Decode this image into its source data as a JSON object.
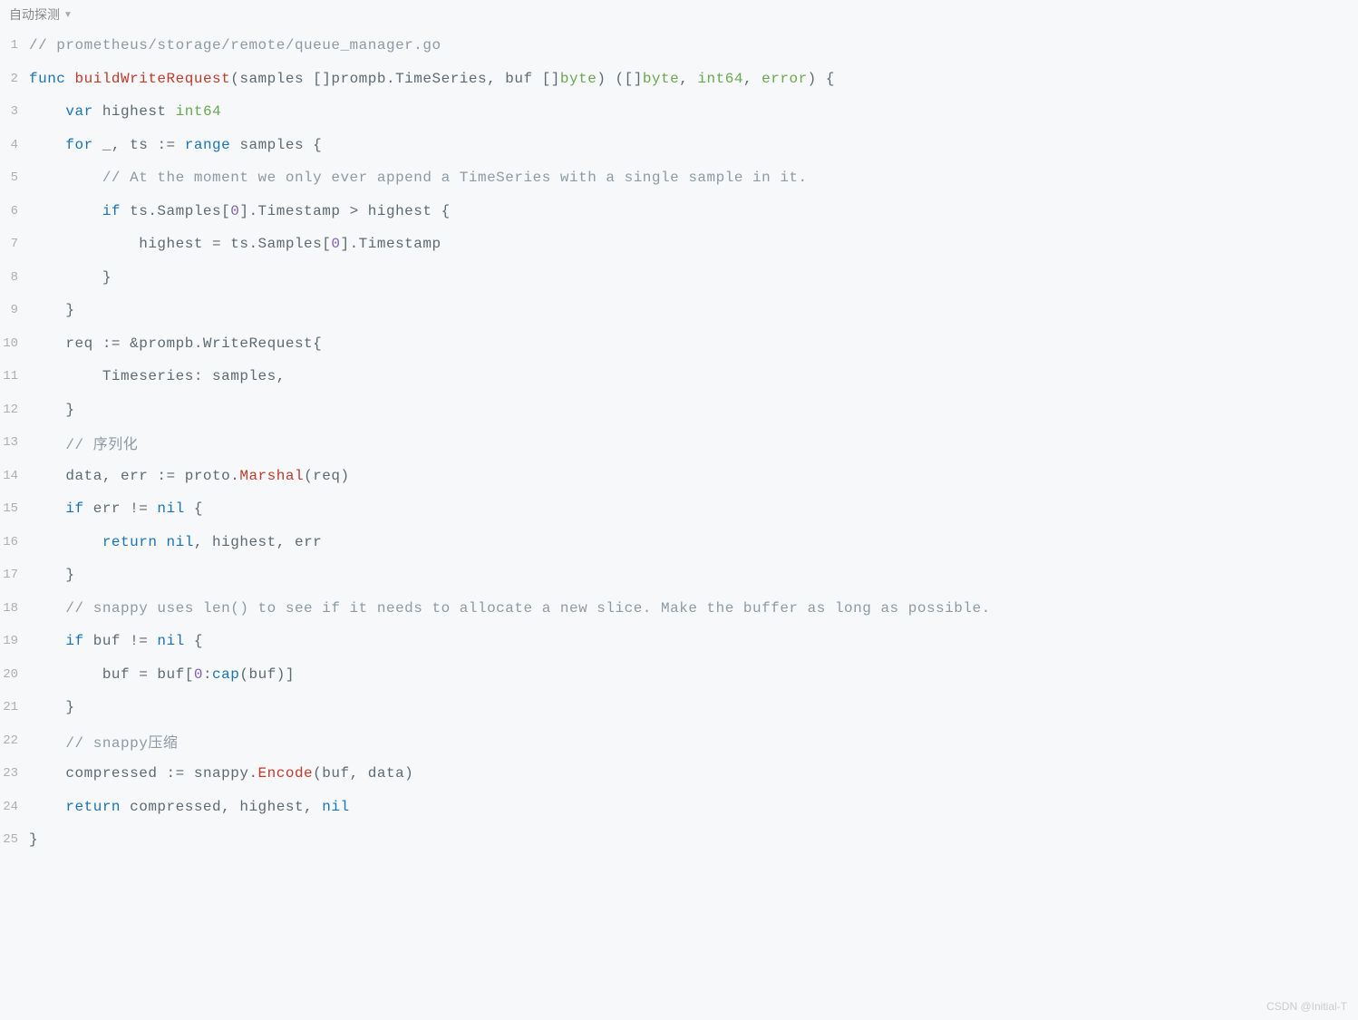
{
  "toolbar": {
    "label": "自动探测"
  },
  "watermark": "CSDN @Initial-T",
  "gutter": {
    "l1": "1",
    "l2": "2",
    "l3": "3",
    "l4": "4",
    "l5": "5",
    "l6": "6",
    "l7": "7",
    "l8": "8",
    "l9": "9",
    "l10": "10",
    "l11": "11",
    "l12": "12",
    "l13": "13",
    "l14": "14",
    "l15": "15",
    "l16": "16",
    "l17": "17",
    "l18": "18",
    "l19": "19",
    "l20": "20",
    "l21": "21",
    "l22": "22",
    "l23": "23",
    "l24": "24",
    "l25": "25"
  },
  "code": {
    "l1_comment": "// prometheus/storage/remote/queue_manager.go",
    "l2": {
      "func": "func",
      "name": "buildWriteRequest",
      "p1": "(samples []prompb.TimeSeries, buf []",
      "byte1": "byte",
      "p2": ") ([]",
      "byte2": "byte",
      "p3": ", ",
      "int64": "int64",
      "p4": ", ",
      "error": "error",
      "p5": ") {"
    },
    "l3": {
      "var": "var",
      "ident": " highest ",
      "type": "int64"
    },
    "l4": {
      "for": "for",
      "blank": " _",
      "p1": ", ts ",
      "assign": ":=",
      "sp": " ",
      "range": "range",
      "rest": " samples {"
    },
    "l5_comment": "// At the moment we only ever append a TimeSeries with a single sample in it.",
    "l6": {
      "if": "if",
      "p1": " ts.Samples[",
      "zero": "0",
      "p2": "].Timestamp > highest {"
    },
    "l7": {
      "p1": "highest = ts.Samples[",
      "zero": "0",
      "p2": "].Timestamp"
    },
    "l8_brace": "}",
    "l9_brace": "}",
    "l10": {
      "p1": "req ",
      "assign": ":=",
      "p2": " &prompb.WriteRequest{"
    },
    "l11": "Timeseries: samples,",
    "l12_brace": "}",
    "l13_comment": "// 序列化",
    "l14": {
      "p1": "data, err ",
      "assign": ":=",
      "p2": " proto.",
      "method": "Marshal",
      "p3": "(req)"
    },
    "l15": {
      "if": "if",
      "p1": " err != ",
      "nil": "nil",
      "p2": " {"
    },
    "l16": {
      "return": "return",
      "sp": " ",
      "nil": "nil",
      "rest": ", highest, err"
    },
    "l17_brace": "}",
    "l18_comment": "// snappy uses len() to see if it needs to allocate a new slice. Make the buffer as long as possible.",
    "l19": {
      "if": "if",
      "p1": " buf != ",
      "nil": "nil",
      "p2": " {"
    },
    "l20": {
      "p1": "buf = buf[",
      "zero": "0",
      "p2": ":",
      "cap": "cap",
      "p3": "(buf)]"
    },
    "l21_brace": "}",
    "l22_comment": "// snappy压缩",
    "l23": {
      "p1": "compressed ",
      "assign": ":=",
      "p2": " snappy.",
      "method": "Encode",
      "p3": "(buf, data)"
    },
    "l24": {
      "return": "return",
      "rest": " compressed, highest, ",
      "nil": "nil"
    },
    "l25_brace": "}"
  },
  "indent": {
    "i1": "    ",
    "i2": "        ",
    "i3": "            "
  }
}
